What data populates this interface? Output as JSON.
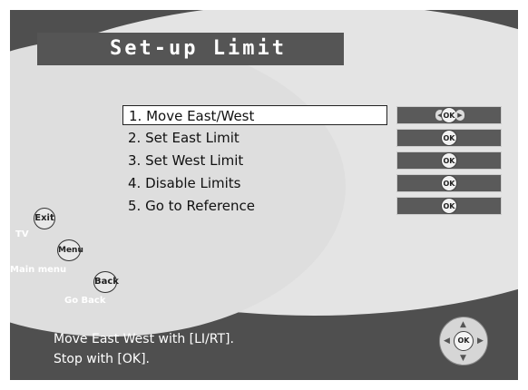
{
  "title": "Set-up Limit",
  "menu": [
    {
      "label": "1. Move East/West",
      "selected": true,
      "control": "arrows-ok"
    },
    {
      "label": "2. Set East Limit",
      "selected": false,
      "control": "ok"
    },
    {
      "label": "3. Set West Limit",
      "selected": false,
      "control": "ok"
    },
    {
      "label": "4. Disable Limits",
      "selected": false,
      "control": "ok"
    },
    {
      "label": "5. Go to Reference",
      "selected": false,
      "control": "ok"
    }
  ],
  "ok_label": "OK",
  "remote_buttons": {
    "exit": {
      "button": "Exit",
      "label": "TV"
    },
    "menu": {
      "button": "Menu",
      "label": "Main menu"
    },
    "back": {
      "button": "Back",
      "label": "Go Back"
    }
  },
  "help": {
    "line1": "Move East West with [LI/RT].",
    "line2": "Stop with [OK]."
  },
  "colors": {
    "frame": "#4f4f4f",
    "background_ellipse": "#e4e4e4",
    "title_bar": "#555555",
    "ok_box": "#5a5a5a"
  }
}
